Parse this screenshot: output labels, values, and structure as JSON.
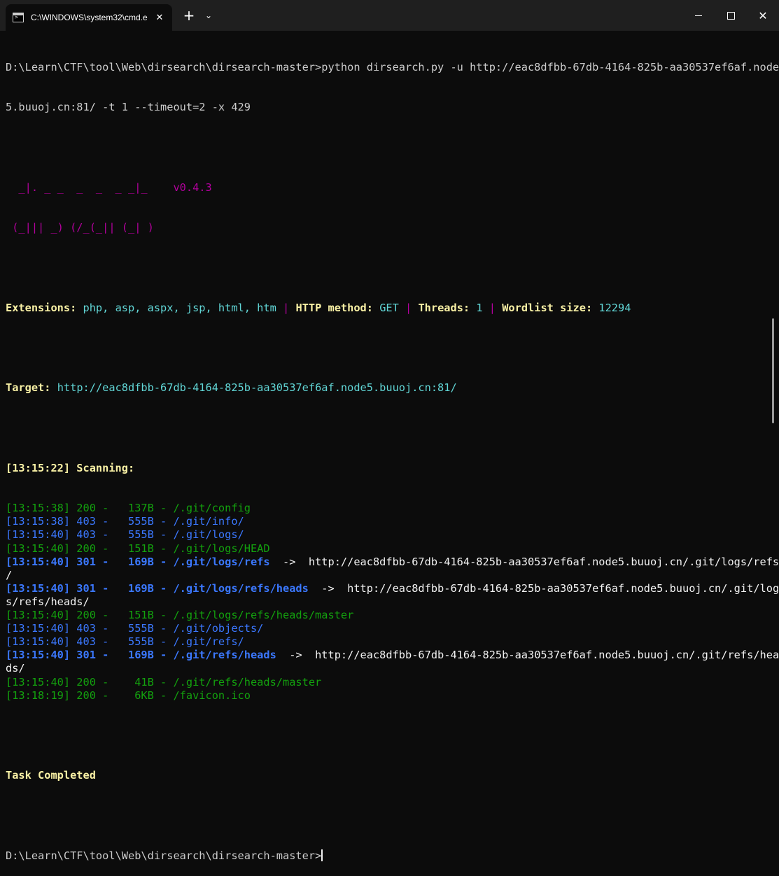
{
  "window": {
    "tab_title": "C:\\WINDOWS\\system32\\cmd.e",
    "tab_close": "✕",
    "new_tab": "+",
    "dropdown": "⌄",
    "close": "✕"
  },
  "terminal": {
    "cmd1": "D:\\Learn\\CTF\\tool\\Web\\dirsearch\\dirsearch-master>python dirsearch.py -u http://eac8dfbb-67db-4164-825b-aa30537ef6af.node",
    "cmd2": "5.buuoj.cn:81/ -t 1 --timeout=2 -x 429",
    "logo1": "  _|. _ _  _  _  _ _|_    v0.4.3",
    "logo2": " (_||| _) (/_(_|| (_| )",
    "ext_label": "Extensions: ",
    "ext_value": "php, asp, aspx, jsp, html, htm",
    "sep": " | ",
    "method_label": "HTTP method: ",
    "method_value": "GET",
    "threads_label": "Threads: ",
    "threads_value": "1",
    "wordlist_label": "Wordlist size: ",
    "wordlist_value": "12294",
    "target_label": "Target: ",
    "target_value": "http://eac8dfbb-67db-4164-825b-aa30537ef6af.node5.buuoj.cn:81/",
    "scanning": "[13:15:22] Scanning:",
    "task_completed": "Task Completed",
    "prompt": "D:\\Learn\\CTF\\tool\\Web\\dirsearch\\dirsearch-master>"
  },
  "results": [
    {
      "text": "[13:15:38] 200 -   137B - /.git/config",
      "color": "#13a10e"
    },
    {
      "text": "[13:15:38] 403 -   555B - /.git/info/",
      "color": "#3b78ff"
    },
    {
      "text": "[13:15:40] 403 -   555B - /.git/logs/",
      "color": "#3b78ff"
    },
    {
      "text": "[13:15:40] 200 -   151B - /.git/logs/HEAD",
      "color": "#13a10e"
    },
    {
      "text": "[13:15:40] 301 -   169B - /.git/logs/refs",
      "redirect": "  ->  http://eac8dfbb-67db-4164-825b-aa30537ef6af.node5.buuoj.cn/.git/logs/refs",
      "wrap": "/",
      "color": "#3b78ff"
    },
    {
      "text": "[13:15:40] 301 -   169B - /.git/logs/refs/heads",
      "redirect": "  ->  http://eac8dfbb-67db-4164-825b-aa30537ef6af.node5.buuoj.cn/.git/log",
      "wrap": "s/refs/heads/",
      "color": "#3b78ff"
    },
    {
      "text": "[13:15:40] 200 -   151B - /.git/logs/refs/heads/master",
      "color": "#13a10e"
    },
    {
      "text": "[13:15:40] 403 -   555B - /.git/objects/",
      "color": "#3b78ff"
    },
    {
      "text": "[13:15:40] 403 -   555B - /.git/refs/",
      "color": "#3b78ff"
    },
    {
      "text": "[13:15:40] 301 -   169B - /.git/refs/heads",
      "redirect": "  ->  http://eac8dfbb-67db-4164-825b-aa30537ef6af.node5.buuoj.cn/.git/refs/hea",
      "wrap": "ds/",
      "color": "#3b78ff"
    },
    {
      "text": "[13:15:40] 200 -    41B - /.git/refs/heads/master",
      "color": "#13a10e"
    },
    {
      "text": "[13:18:19] 200 -    6KB - /favicon.ico",
      "color": "#13a10e"
    }
  ],
  "colors": {
    "background": "#0c0c0c",
    "green": "#13a10e",
    "blue": "#3b78ff",
    "yellow": "#f9f1a5",
    "cyan": "#61d6d6",
    "magenta": "#b4009e"
  },
  "icons": {
    "tab": "cmd-icon",
    "minimize": "minimize-icon",
    "maximize": "maximize-icon",
    "close": "close-icon"
  }
}
